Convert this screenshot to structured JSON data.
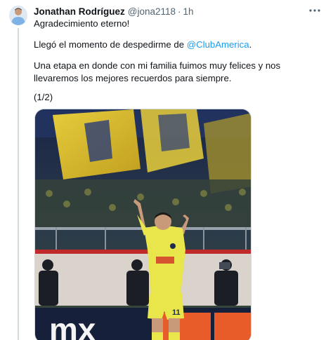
{
  "tweet": {
    "author_name": "Jonathan Rodríguez",
    "author_handle": "@jona2118",
    "separator": "·",
    "timestamp": "1h",
    "line1": "Agradecimiento eterno!",
    "line2_prefix": "Llegó el momento de despedirme de ",
    "line2_mention": "@ClubAmerica",
    "line2_suffix": ".",
    "line3": "Una etapa en donde con mi familia fuimos muy felices y nos llevaremos los mejores recuerdos para siempre.",
    "line4": "(1/2)",
    "jersey_number": "11"
  },
  "icons": {
    "more": "more-horizontal-icon",
    "avatar": "avatar"
  },
  "colors": {
    "link": "#1d9bf0",
    "muted": "#536471",
    "kit_yellow": "#e8e64a",
    "stand_navy": "#1e2b4e"
  }
}
